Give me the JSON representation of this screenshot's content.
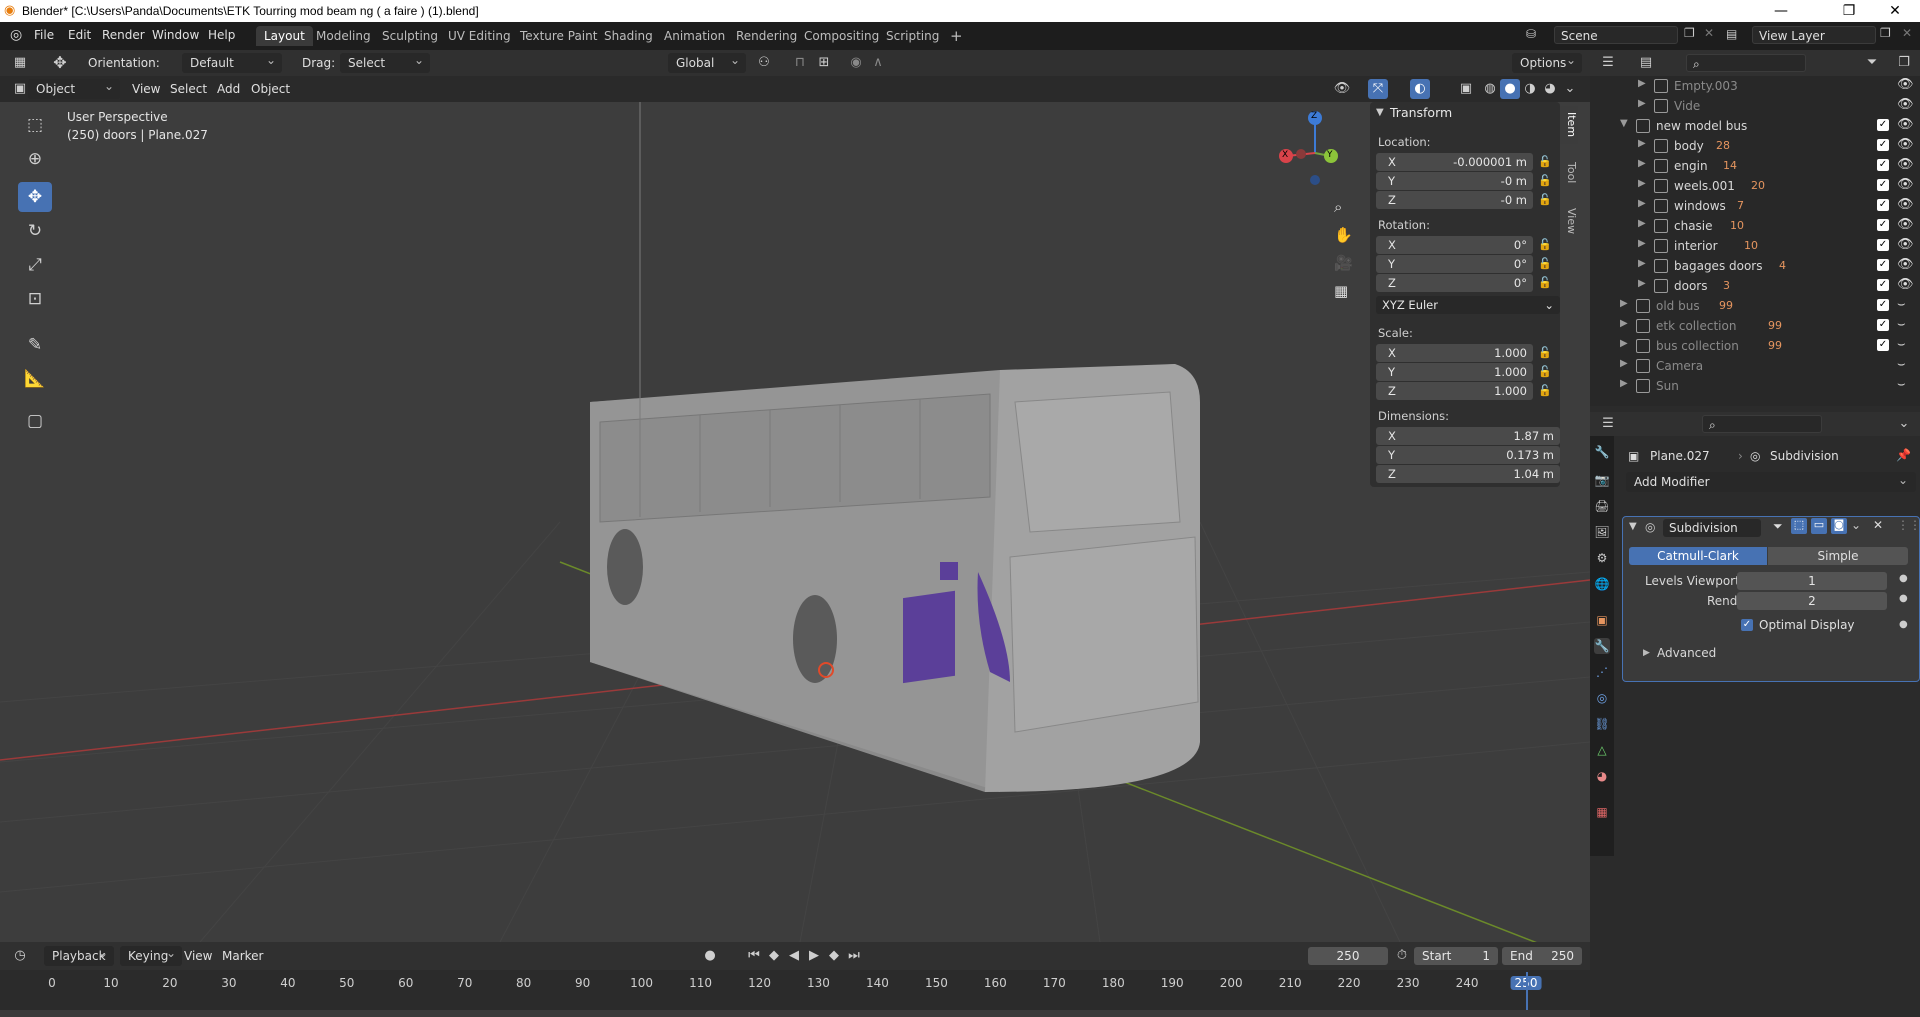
{
  "window": {
    "title": "Blender* [C:\\Users\\Panda\\Documents\\ETK Tourring mod beam ng ( a faire ) (1).blend]",
    "controls": [
      "—",
      "❐",
      "✕"
    ]
  },
  "menu": [
    "File",
    "Edit",
    "Render",
    "Window",
    "Help"
  ],
  "workspaces": [
    "Layout",
    "Modeling",
    "Sculpting",
    "UV Editing",
    "Texture Paint",
    "Shading",
    "Animation",
    "Rendering",
    "Compositing",
    "Scripting"
  ],
  "scene": {
    "name": "Scene",
    "view_layer": "View Layer"
  },
  "viewport_header": {
    "orientation_label": "Orientation:",
    "orientation_value": "Default",
    "drag_label": "Drag:",
    "drag_value": "Select Box",
    "transform_space": "Global",
    "options": "Options",
    "mode": "Object Mode",
    "menus": [
      "View",
      "Select",
      "Add",
      "Object"
    ]
  },
  "overlay_text": {
    "perspective": "User Perspective",
    "object": "(250) doors | Plane.027"
  },
  "gizmo": {
    "x": "X",
    "y": "Y",
    "z": "Z"
  },
  "transform_panel": {
    "title": "Transform",
    "location_label": "Location:",
    "location": {
      "x": "-0.000001 m",
      "y": "-0 m",
      "z": "-0 m"
    },
    "rotation_label": "Rotation:",
    "rotation": {
      "x": "0°",
      "y": "0°",
      "z": "0°"
    },
    "rotation_mode": "XYZ Euler",
    "scale_label": "Scale:",
    "scale": {
      "x": "1.000",
      "y": "1.000",
      "z": "1.000"
    },
    "dimensions_label": "Dimensions:",
    "dimensions": {
      "x": "1.87 m",
      "y": "0.173 m",
      "z": "1.04 m"
    },
    "axis": {
      "x": "X",
      "y": "Y",
      "z": "Z"
    }
  },
  "npanel_tabs": [
    "Item",
    "Tool",
    "View"
  ],
  "outliner": {
    "rows": [
      {
        "name": "Empty.003",
        "level": 2,
        "dim": true,
        "tag": ""
      },
      {
        "name": "Vide",
        "level": 2,
        "dim": true,
        "tag": ""
      },
      {
        "name": "new model bus",
        "level": 1,
        "dim": false,
        "tag": ""
      },
      {
        "name": "body",
        "level": 2,
        "dim": false,
        "tag": "28"
      },
      {
        "name": "engin",
        "level": 2,
        "dim": false,
        "tag": "14"
      },
      {
        "name": "weels.001",
        "level": 2,
        "dim": false,
        "tag": "20"
      },
      {
        "name": "windows",
        "level": 2,
        "dim": false,
        "tag": "7"
      },
      {
        "name": "chasie",
        "level": 2,
        "dim": false,
        "tag": "10"
      },
      {
        "name": "interior",
        "level": 2,
        "dim": false,
        "tag": "10"
      },
      {
        "name": "bagages doors",
        "level": 2,
        "dim": false,
        "tag": "4"
      },
      {
        "name": "doors",
        "level": 2,
        "dim": false,
        "tag": "3"
      },
      {
        "name": "old bus",
        "level": 1,
        "dim": true,
        "tag": "99"
      },
      {
        "name": "etk collection",
        "level": 1,
        "dim": true,
        "tag": "99"
      },
      {
        "name": "bus collection",
        "level": 1,
        "dim": true,
        "tag": "99"
      },
      {
        "name": "Camera",
        "level": 1,
        "dim": true,
        "tag": ""
      },
      {
        "name": "Sun",
        "level": 1,
        "dim": true,
        "tag": ""
      }
    ]
  },
  "properties": {
    "object_name": "Plane.027",
    "modifier_context": "Subdivision",
    "add_modifier": "Add Modifier",
    "modifier": {
      "name": "Subdivision",
      "mode_a": "Catmull-Clark",
      "mode_b": "Simple",
      "levels_viewport_label": "Levels Viewport",
      "levels_viewport": "1",
      "render_label": "Render",
      "render": "2",
      "optimal_display": "Optimal Display",
      "advanced": "Advanced"
    }
  },
  "timeline": {
    "menus": [
      "Playback",
      "Keying",
      "View",
      "Marker"
    ],
    "current_frame": "250",
    "start_label": "Start",
    "start": "1",
    "end_label": "End",
    "end": "250",
    "ticks": [
      "0",
      "10",
      "20",
      "30",
      "40",
      "50",
      "60",
      "70",
      "80",
      "90",
      "100",
      "110",
      "120",
      "130",
      "140",
      "150",
      "160",
      "170",
      "180",
      "190",
      "200",
      "210",
      "220",
      "230",
      "240",
      "250"
    ]
  }
}
